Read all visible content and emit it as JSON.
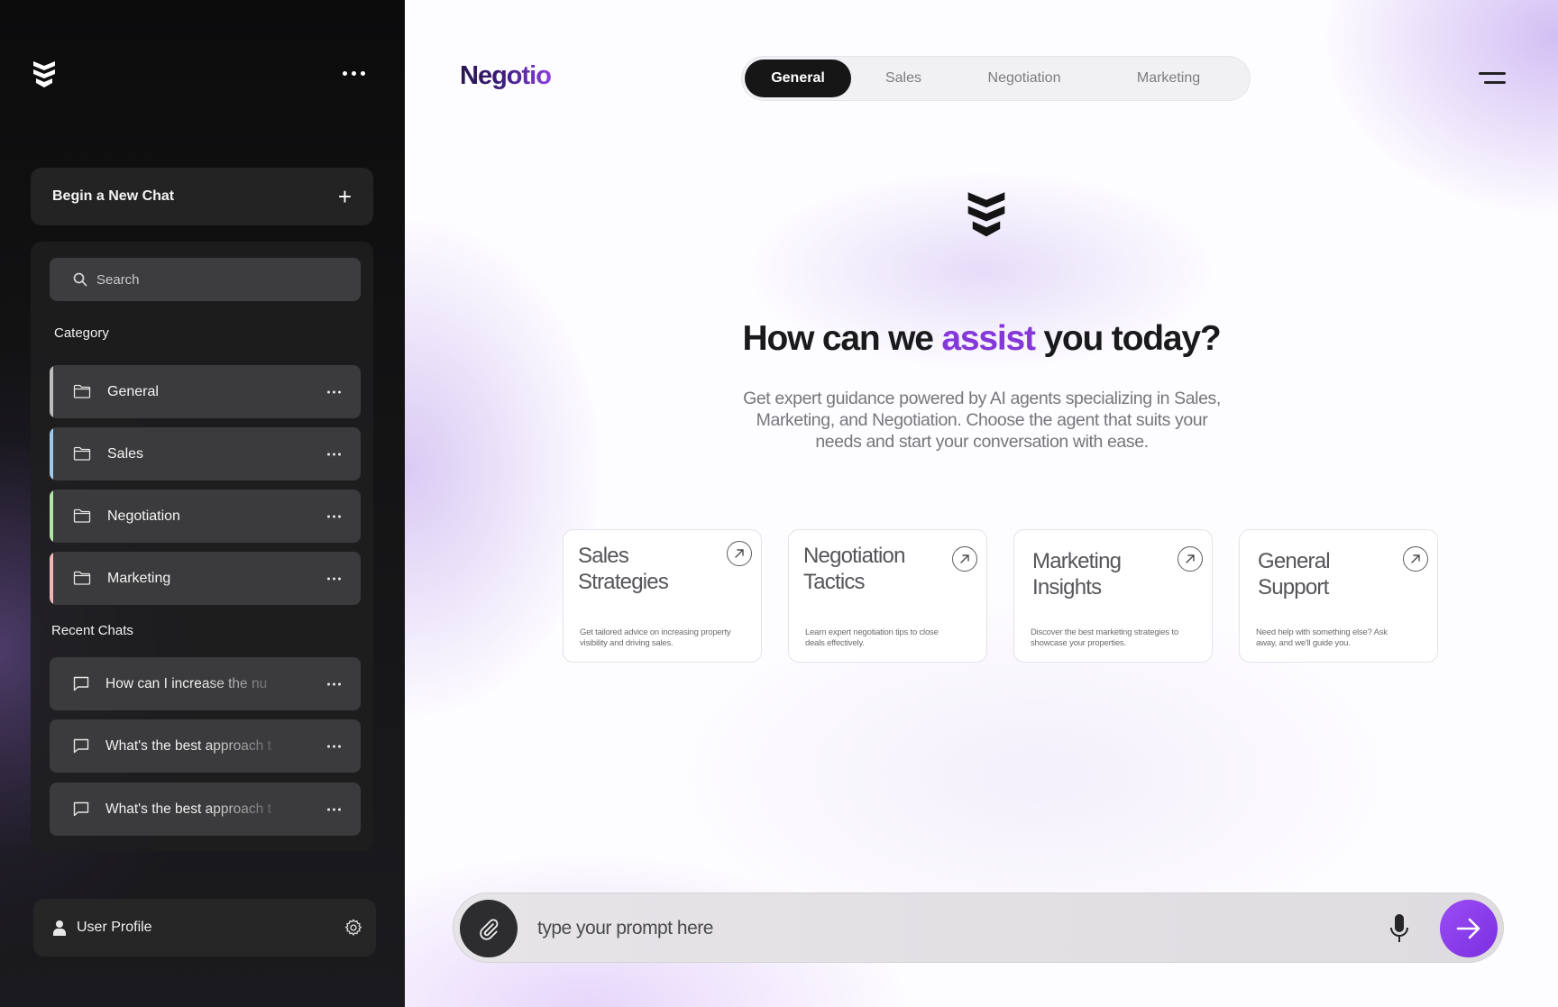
{
  "sidebar": {
    "logo_icon": "stacked-chevrons-logo",
    "more_icon": "ellipsis-icon",
    "new_chat_label": "Begin a New Chat",
    "search_placeholder": "Search",
    "category_heading": "Category",
    "categories": [
      {
        "label": "General",
        "accent": "#bdbdbd"
      },
      {
        "label": "Sales",
        "accent": "#9cc9ec"
      },
      {
        "label": "Negotiation",
        "accent": "#b3e6a4"
      },
      {
        "label": "Marketing",
        "accent": "#f3b6b6"
      }
    ],
    "recent_heading": "Recent Chats",
    "recent_chats": [
      {
        "label": "How can I increase the nu"
      },
      {
        "label": "What's the best approach t"
      },
      {
        "label": "What's the best approach t"
      }
    ],
    "profile_label": "User Profile"
  },
  "header": {
    "brand": "Negotio",
    "tabs": [
      {
        "label": "General",
        "active": true
      },
      {
        "label": "Sales",
        "active": false
      },
      {
        "label": "Negotiation",
        "active": false
      },
      {
        "label": "Marketing",
        "active": false
      }
    ],
    "menu_icon": "hamburger-menu-icon"
  },
  "hero": {
    "heading_before": "How can we ",
    "heading_accent": "assist",
    "heading_after": " you today?",
    "subtext": "Get expert guidance powered by AI agents specializing in Sales, Marketing, and Negotiation. Choose the agent that suits your needs and start your conversation with ease."
  },
  "cards": [
    {
      "title": "Sales Strategies",
      "desc": "Get tailored advice on increasing property visibility and driving sales."
    },
    {
      "title": "Negotiation Tactics",
      "desc": "Learn expert negotiation tips to close deals effectively."
    },
    {
      "title": "Marketing Insights",
      "desc": "Discover the best marketing strategies to showcase your properties."
    },
    {
      "title": "General Support",
      "desc": "Need help with something else? Ask away, and we'll guide you."
    }
  ],
  "prompt": {
    "placeholder": "type your prompt here",
    "value": ""
  },
  "colors": {
    "accent": "#8438d8",
    "send_button": "#8a3ff0",
    "sidebar_bg": "#141415"
  }
}
